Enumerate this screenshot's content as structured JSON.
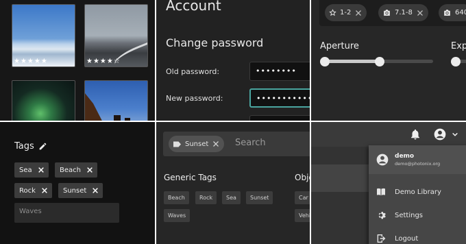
{
  "gallery": {
    "photos": [
      {
        "stars": "★★★★★"
      },
      {
        "stars": "★★★★☆"
      },
      {
        "stars": ""
      },
      {
        "stars": ""
      }
    ]
  },
  "account": {
    "title": "Account",
    "section": "Change password",
    "old_label": "Old password:",
    "old_value": "••••••••",
    "new_label": "New password:",
    "new_value": "••••••••••••••"
  },
  "filters": {
    "chips": [
      {
        "label": "1-2",
        "icon": "star-outline-icon"
      },
      {
        "label": "7.1-8",
        "icon": "camera-icon"
      },
      {
        "label": "640",
        "icon": "camera-icon"
      }
    ],
    "sliders": [
      {
        "label": "Aperture",
        "range": [
          0.0,
          0.5
        ]
      },
      {
        "label": "Exp",
        "range": [
          0.0,
          0.0
        ]
      }
    ]
  },
  "tags_panel": {
    "title": "Tags",
    "tags": [
      "Sea",
      "Beach",
      "Rock",
      "Sunset"
    ],
    "input_placeholder": "Waves"
  },
  "search_panel": {
    "chip": "Sunset",
    "placeholder": "Search",
    "generic_title": "Generic Tags",
    "object_title": "Obje",
    "generic_tags": [
      "Beach",
      "Rock",
      "Sea",
      "Sunset",
      "Waves"
    ],
    "object_tags": [
      "Car",
      "Vehi"
    ]
  },
  "user_menu": {
    "name": "demo",
    "email": "demo@photonix.org",
    "items": [
      {
        "label": "Demo Library",
        "icon": "library-icon"
      },
      {
        "label": "Settings",
        "icon": "gear-icon"
      },
      {
        "label": "Logout",
        "icon": "logout-icon"
      }
    ]
  },
  "colors": {
    "accent": "#4aa6a0",
    "chip_bg": "#3c3c3c",
    "panel_bg": "#262626"
  }
}
